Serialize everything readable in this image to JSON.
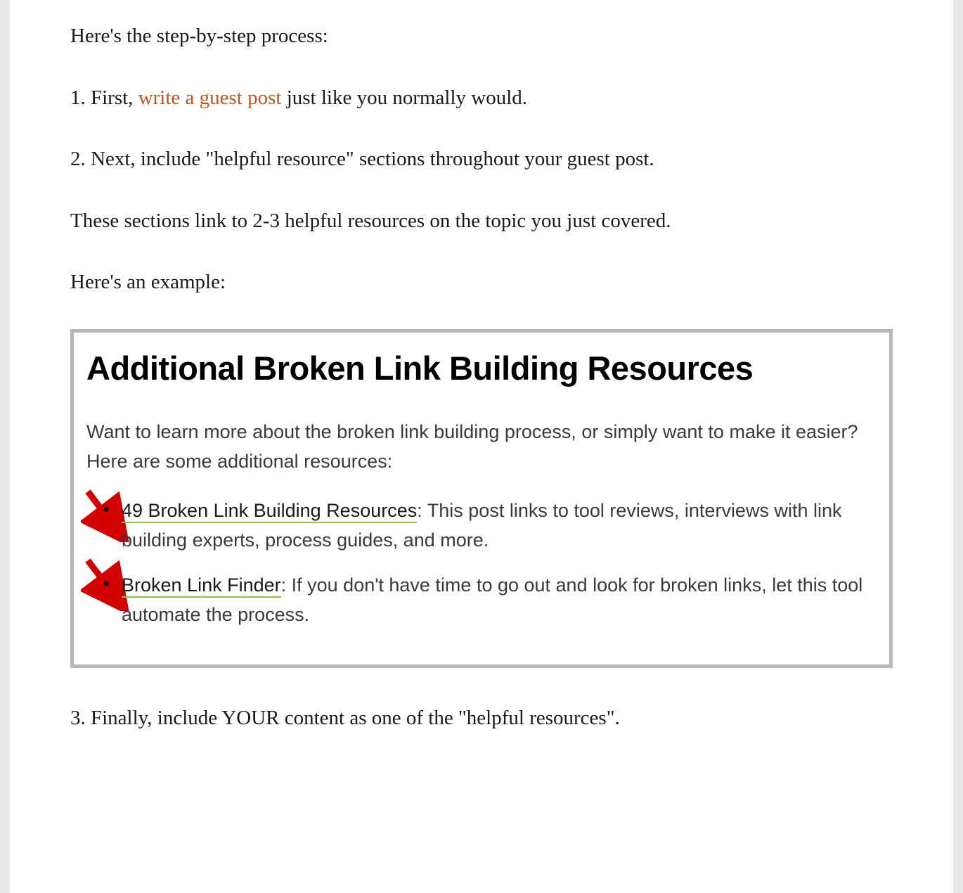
{
  "intro": "Here's the step-by-step process:",
  "step1_prefix": "1. First, ",
  "step1_link": "write a guest post",
  "step1_suffix": " just like you normally would.",
  "step2": "2. Next, include \"helpful resource\" sections throughout your guest post.",
  "step2b": "These sections link to 2-3 helpful resources on the topic you just covered.",
  "example_lead": "Here's an example:",
  "box": {
    "heading": "Additional Broken Link Building Resources",
    "intro": "Want to learn more about the broken link building process, or simply want to make it easier? Here are some additional resources:",
    "items": [
      {
        "link": "49 Broken Link Building Resources",
        "desc": " This post links to tool reviews, interviews with link building experts, process guides, and more."
      },
      {
        "link": "Broken Link Finder",
        "desc": " If you don't have time to go out and look for broken links, let this tool automate the process."
      }
    ]
  },
  "step3": "3. Finally, include YOUR content as one of the \"helpful resources\"."
}
